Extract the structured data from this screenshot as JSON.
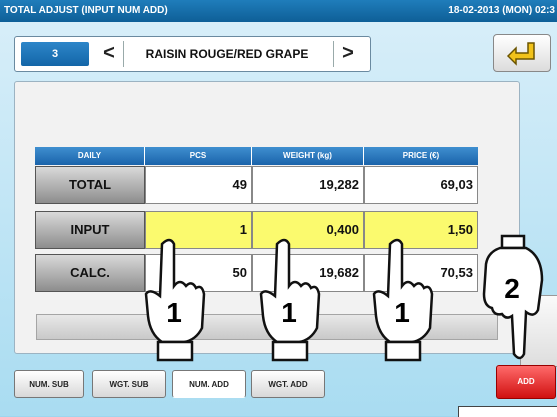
{
  "titlebar": {
    "title": "TOTAL ADJUST (INPUT NUM ADD)",
    "datetime": "18-02-2013 (MON) 02:3"
  },
  "nav": {
    "number": "3",
    "prev": "<",
    "name": "RAISIN ROUGE/RED GRAPE",
    "next": ">"
  },
  "table": {
    "headers": [
      "DAILY",
      "PCS",
      "WEIGHT (kg)",
      "PRICE (€)"
    ],
    "rows": [
      {
        "label": "TOTAL",
        "pcs": "49",
        "weight": "19,282",
        "price": "69,03"
      },
      {
        "label": "INPUT",
        "pcs": "1",
        "weight": "0,400",
        "price": "1,50"
      },
      {
        "label": "CALC.",
        "pcs": "50",
        "weight": "19,682",
        "price": "70,53"
      }
    ],
    "input_highlight_color": "#fbfa6e"
  },
  "tabs": [
    "NUM. SUB",
    "WGT. SUB",
    "NUM. ADD",
    "WGT. ADD"
  ],
  "selected_tab": "NUM. ADD",
  "add_button": "ADD",
  "hand_labels": [
    "1",
    "1",
    "1",
    "2"
  ],
  "icons": {
    "back": "return-arrow-icon",
    "hand": "pointing-hand-icon"
  }
}
